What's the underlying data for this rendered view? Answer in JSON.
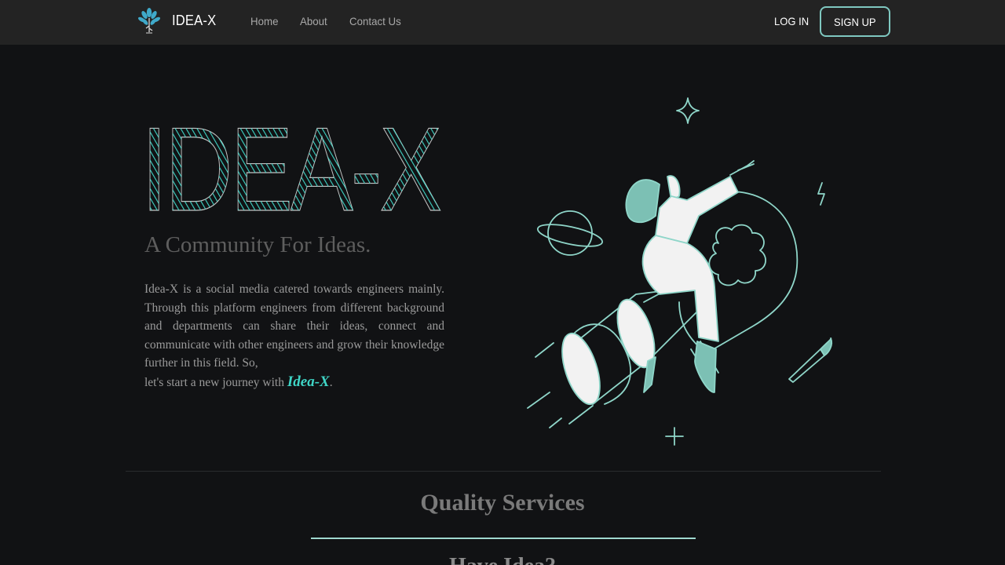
{
  "nav": {
    "brand": "IDEA-X",
    "links": [
      "Home",
      "About",
      "Contact Us"
    ],
    "login": "LOG IN",
    "signup": "SIGN UP"
  },
  "hero": {
    "title": "IDEA-X",
    "tagline": "A Community For Ideas.",
    "description": "Idea-X is a social media catered towards engineers mainly. Through this platform engineers from different background and departments can share their ideas, connect and communicate with other engineers and grow their knowledge further in this field. So,",
    "description_end": "let's start a new journey with",
    "brand_emphasis": "Idea-X",
    "period": "."
  },
  "services": {
    "title": "Quality Services",
    "subtitle": "Have Idea?"
  },
  "colors": {
    "accent": "#3fd5c6",
    "accent_soft": "#9fd8cf",
    "navbar": "#232323",
    "background": "#111214"
  },
  "icons": {
    "logo": "tree-icon",
    "illustration": "rocket-lightbulb-illustration"
  }
}
